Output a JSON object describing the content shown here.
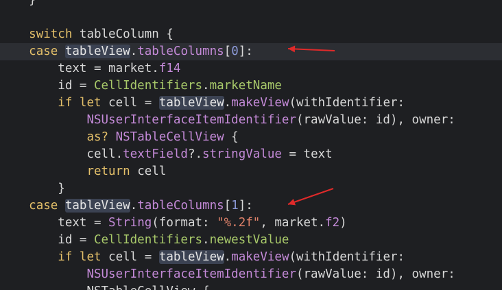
{
  "editor": {
    "language": "swift",
    "lines": [
      {
        "tokens": [
          {
            "t": "    }",
            "c": "plain"
          }
        ]
      },
      {
        "tokens": []
      },
      {
        "tokens": [
          {
            "t": "    ",
            "c": "plain"
          },
          {
            "t": "switch",
            "c": "kw"
          },
          {
            "t": " tableColumn {",
            "c": "plain"
          }
        ]
      },
      {
        "current": true,
        "tokens": [
          {
            "t": "    ",
            "c": "plain"
          },
          {
            "t": "case",
            "c": "kw"
          },
          {
            "t": " ",
            "c": "plain"
          },
          {
            "t": "tableView",
            "c": "hl"
          },
          {
            "t": ".",
            "c": "plain"
          },
          {
            "t": "tableColumns",
            "c": "prop"
          },
          {
            "t": "[",
            "c": "plain"
          },
          {
            "t": "0",
            "c": "num"
          },
          {
            "t": "]:",
            "c": "plain"
          }
        ]
      },
      {
        "tokens": [
          {
            "t": "        text = market.",
            "c": "plain"
          },
          {
            "t": "f14",
            "c": "prop"
          }
        ]
      },
      {
        "tokens": [
          {
            "t": "        id = ",
            "c": "plain"
          },
          {
            "t": "CellIdentifiers",
            "c": "type"
          },
          {
            "t": ".",
            "c": "plain"
          },
          {
            "t": "marketName",
            "c": "type"
          }
        ]
      },
      {
        "tokens": [
          {
            "t": "        ",
            "c": "plain"
          },
          {
            "t": "if let",
            "c": "kw"
          },
          {
            "t": " cell = ",
            "c": "plain"
          },
          {
            "t": "tableView",
            "c": "hl"
          },
          {
            "t": ".",
            "c": "plain"
          },
          {
            "t": "makeView",
            "c": "prop"
          },
          {
            "t": "(withIdentifier:",
            "c": "plain"
          }
        ]
      },
      {
        "tokens": [
          {
            "t": "            ",
            "c": "plain"
          },
          {
            "t": "NSUserInterfaceItemIdentifier",
            "c": "prop"
          },
          {
            "t": "(rawValue: id), owner:",
            "c": "plain"
          }
        ]
      },
      {
        "tokens": [
          {
            "t": "            ",
            "c": "plain"
          },
          {
            "t": "as?",
            "c": "kw"
          },
          {
            "t": " ",
            "c": "plain"
          },
          {
            "t": "NSTableCellView",
            "c": "prop"
          },
          {
            "t": " {",
            "c": "plain"
          }
        ]
      },
      {
        "tokens": [
          {
            "t": "            cell.",
            "c": "plain"
          },
          {
            "t": "textField",
            "c": "prop"
          },
          {
            "t": "?.",
            "c": "plain"
          },
          {
            "t": "stringValue",
            "c": "prop"
          },
          {
            "t": " = text",
            "c": "plain"
          }
        ]
      },
      {
        "tokens": [
          {
            "t": "            ",
            "c": "plain"
          },
          {
            "t": "return",
            "c": "kw"
          },
          {
            "t": " cell",
            "c": "plain"
          }
        ]
      },
      {
        "tokens": [
          {
            "t": "        }",
            "c": "plain"
          }
        ]
      },
      {
        "tokens": [
          {
            "t": "    ",
            "c": "plain"
          },
          {
            "t": "case",
            "c": "kw"
          },
          {
            "t": " ",
            "c": "plain"
          },
          {
            "t": "tableView",
            "c": "hl"
          },
          {
            "t": ".",
            "c": "plain"
          },
          {
            "t": "tableColumns",
            "c": "prop"
          },
          {
            "t": "[",
            "c": "plain"
          },
          {
            "t": "1",
            "c": "num"
          },
          {
            "t": "]:",
            "c": "plain"
          }
        ]
      },
      {
        "tokens": [
          {
            "t": "        text = ",
            "c": "plain"
          },
          {
            "t": "String",
            "c": "prop"
          },
          {
            "t": "(format: ",
            "c": "plain"
          },
          {
            "t": "\"%.2f\"",
            "c": "str"
          },
          {
            "t": ", market.",
            "c": "plain"
          },
          {
            "t": "f2",
            "c": "prop"
          },
          {
            "t": ")",
            "c": "plain"
          }
        ]
      },
      {
        "tokens": [
          {
            "t": "        id = ",
            "c": "plain"
          },
          {
            "t": "CellIdentifiers",
            "c": "type"
          },
          {
            "t": ".",
            "c": "plain"
          },
          {
            "t": "newestValue",
            "c": "type"
          }
        ]
      },
      {
        "tokens": [
          {
            "t": "        ",
            "c": "plain"
          },
          {
            "t": "if let",
            "c": "kw"
          },
          {
            "t": " cell = ",
            "c": "plain"
          },
          {
            "t": "tableView",
            "c": "hl"
          },
          {
            "t": ".",
            "c": "plain"
          },
          {
            "t": "makeView",
            "c": "prop"
          },
          {
            "t": "(withIdentifier:",
            "c": "plain"
          }
        ]
      },
      {
        "tokens": [
          {
            "t": "            ",
            "c": "plain"
          },
          {
            "t": "NSUserInterfaceItemIdentifier",
            "c": "prop"
          },
          {
            "t": "(rawValue: id), owner:",
            "c": "plain"
          }
        ]
      },
      {
        "tokens": [
          {
            "t": "            NSTableCellView {",
            "c": "plain"
          }
        ]
      }
    ]
  },
  "annotations": {
    "arrow_color": "#e02a2a",
    "arrows": [
      {
        "name": "arrow-case-column-0",
        "target_line": 3
      },
      {
        "name": "arrow-case-column-1",
        "target_line": 12
      }
    ]
  },
  "colors": {
    "background": "#1e1f22",
    "current_line": "#2c2e33",
    "keyword": "#e4c06a",
    "type": "#a8c96a",
    "property": "#c48ad8",
    "number": "#8c9ad8",
    "string": "#e0826a",
    "plain": "#d8d8d8",
    "highlight": "#3b4252"
  }
}
